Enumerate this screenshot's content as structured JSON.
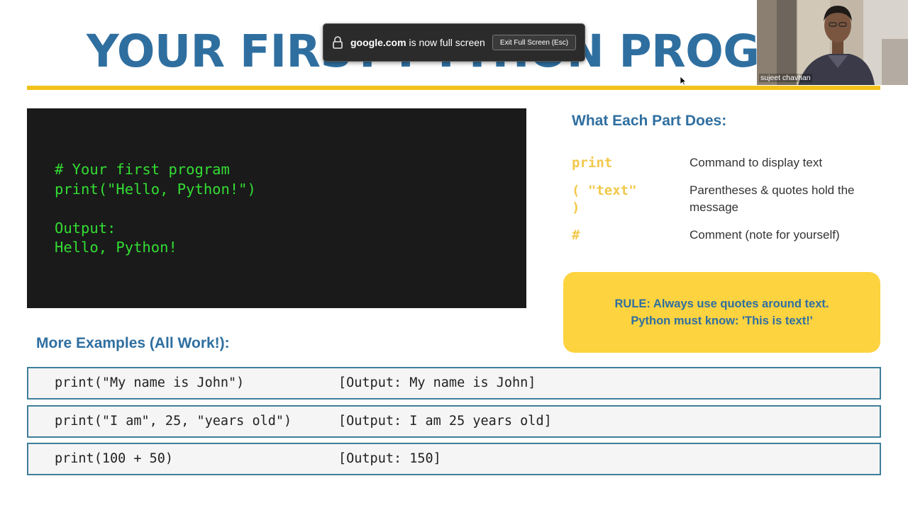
{
  "slide": {
    "title": "YOUR FIRST PYTHON PROGRAM",
    "code_block": {
      "lines": [
        "# Your first program",
        "print(\"Hello, Python!\")",
        "",
        "Output:",
        "Hello, Python!"
      ]
    },
    "parts": {
      "heading": "What Each Part Does:",
      "items": [
        {
          "code": "print",
          "desc": "Command to display text"
        },
        {
          "code": "( \"text\" )",
          "desc": "Parentheses & quotes hold the message"
        },
        {
          "code": "#",
          "desc": "Comment (note for yourself)"
        }
      ]
    },
    "rule": {
      "text": "RULE: Always use quotes around text. Python must know: 'This is text!'"
    },
    "examples": {
      "heading": "More Examples (All Work!):",
      "rows": [
        {
          "code": "print(\"My name is John\")",
          "output": "[Output: My name is John]"
        },
        {
          "code": "print(\"I am\", 25, \"years old\")",
          "output": "[Output: I am 25 years old]"
        },
        {
          "code": "print(100 + 50)",
          "output": "[Output: 150]"
        }
      ]
    }
  },
  "fullscreen_notice": {
    "domain": "google.com",
    "message": "is now full screen",
    "exit_label": "Exit Full Screen (Esc)"
  },
  "webcam": {
    "participant_name": "sujeet chavhan"
  },
  "colors": {
    "title_blue": "#2f6fa0",
    "accent_yellow": "#f2c21b",
    "code_green": "#33dd33",
    "code_bg": "#1a1a1a",
    "rule_bg": "#fdd33f",
    "row_border": "#3f7f9a"
  },
  "icons": {
    "lock": "lock-icon",
    "cursor": "mouse-cursor-icon"
  }
}
